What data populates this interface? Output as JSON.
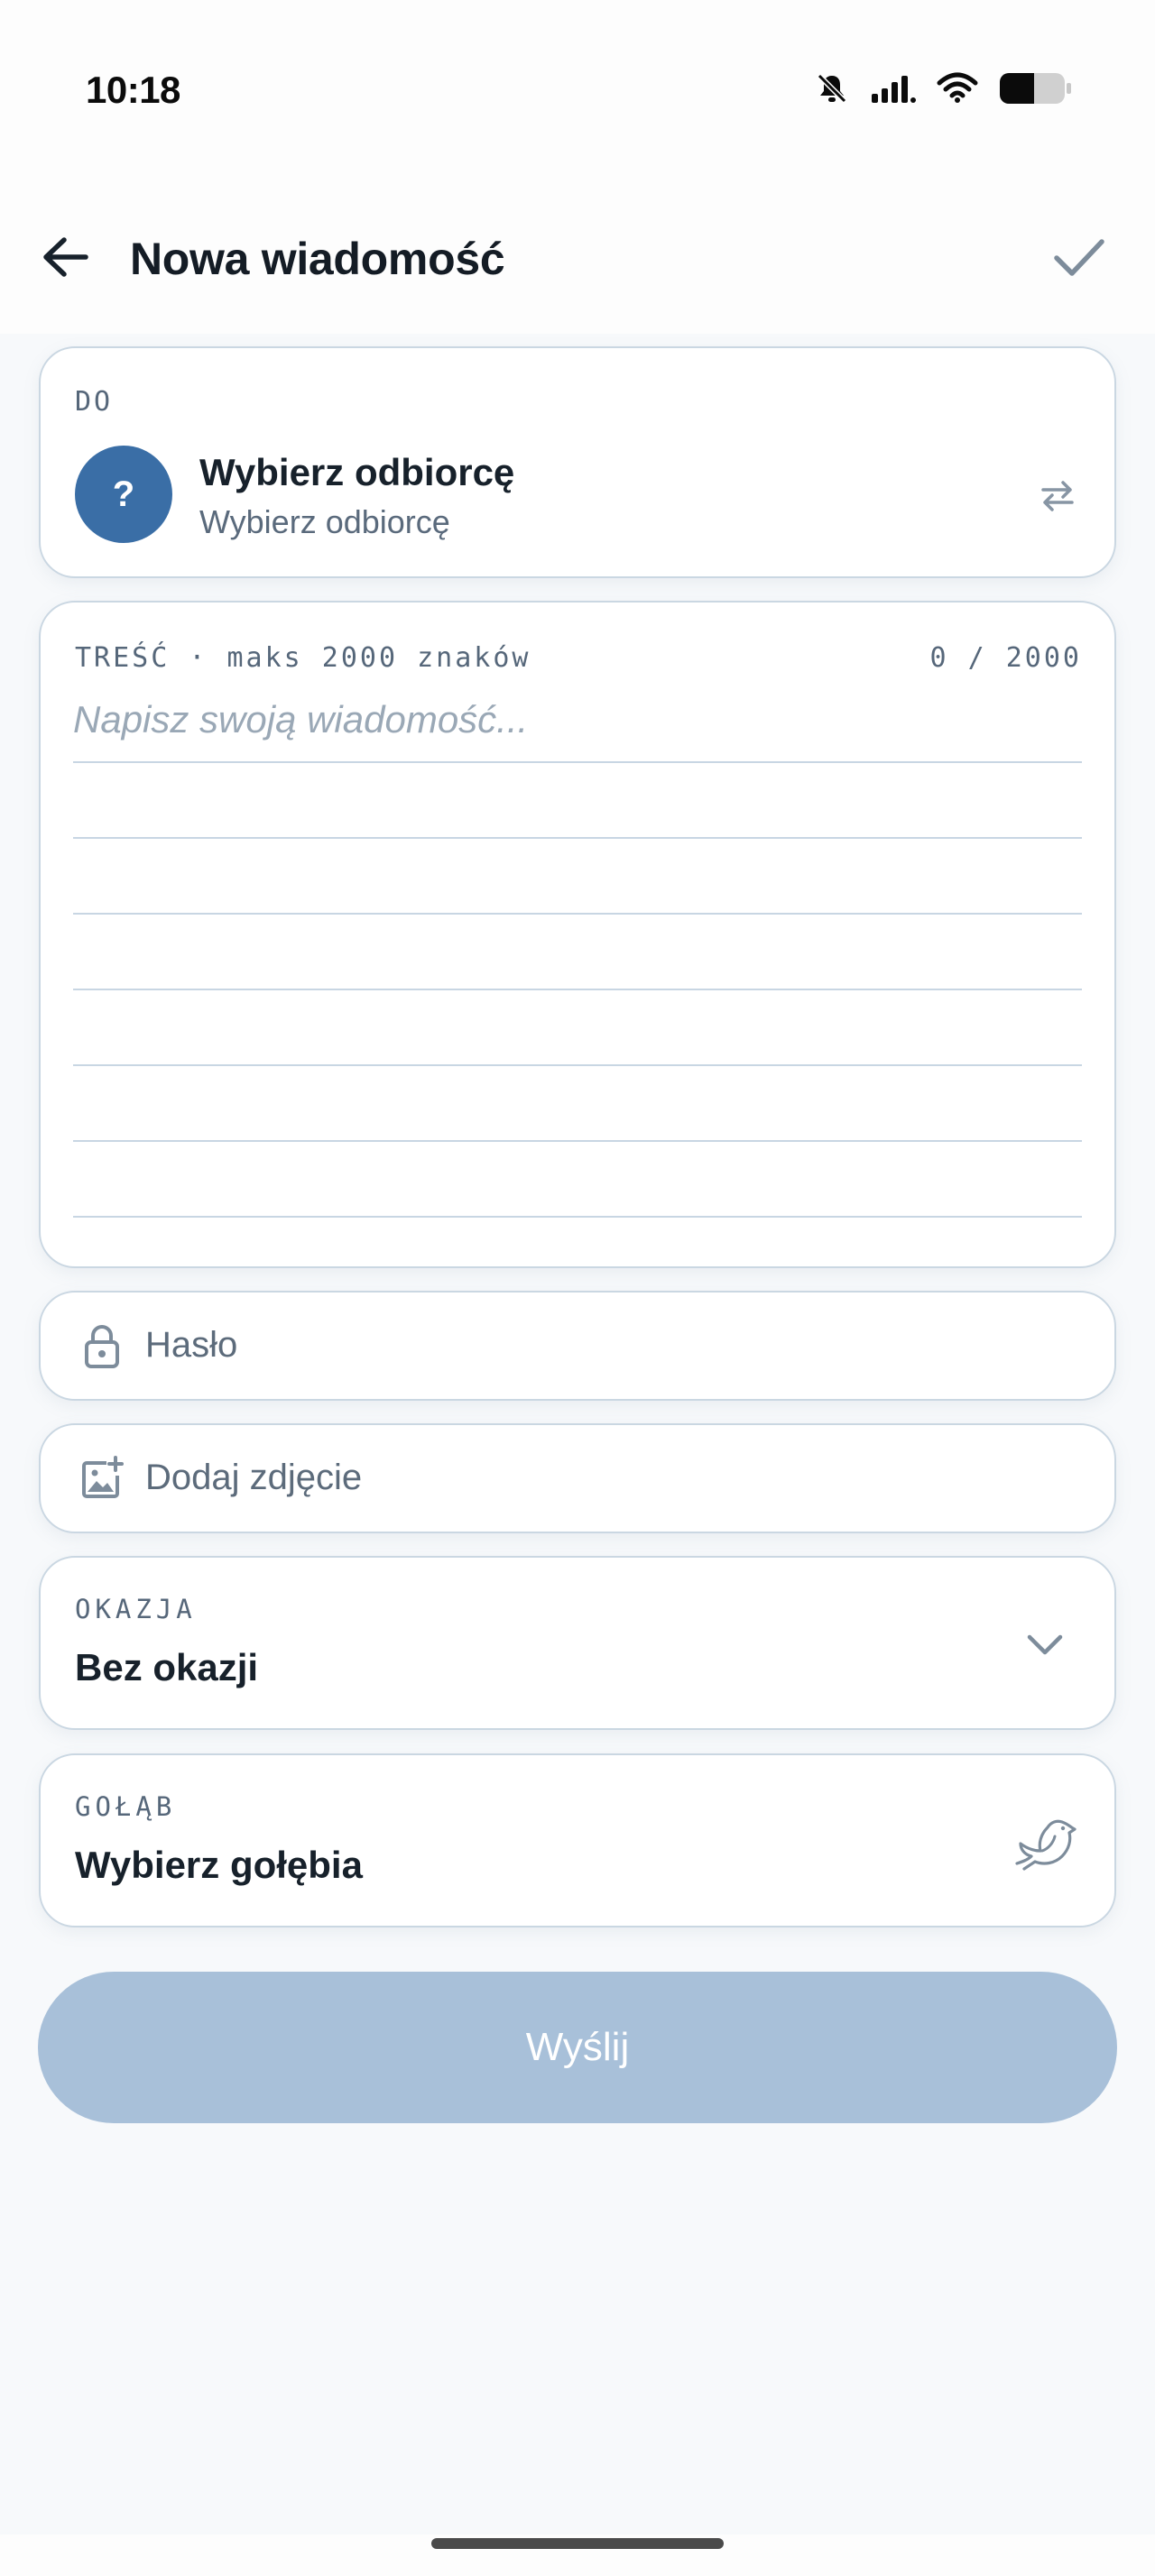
{
  "status_bar": {
    "time": "10:18"
  },
  "header": {
    "title": "Nowa wiadomość"
  },
  "recipient": {
    "label": "DO",
    "avatar_text": "?",
    "name": "Wybierz odbiorcę",
    "subtitle": "Wybierz odbiorcę"
  },
  "message": {
    "label": "TREŚĆ · maks 2000 znaków",
    "counter": "0 / 2000",
    "placeholder": "Napisz swoją wiadomość..."
  },
  "password": {
    "placeholder": "Hasło"
  },
  "photo": {
    "label": "Dodaj zdjęcie"
  },
  "occasion": {
    "label": "OKAZJA",
    "value": "Bez okazji"
  },
  "pigeon": {
    "label": "GOŁĄB",
    "value": "Wybierz gołębia"
  },
  "send": {
    "label": "Wyślij"
  },
  "colors": {
    "accent": "#3a6ea6",
    "button_disabled": "#a8c0d9",
    "border": "#cad7e2"
  }
}
